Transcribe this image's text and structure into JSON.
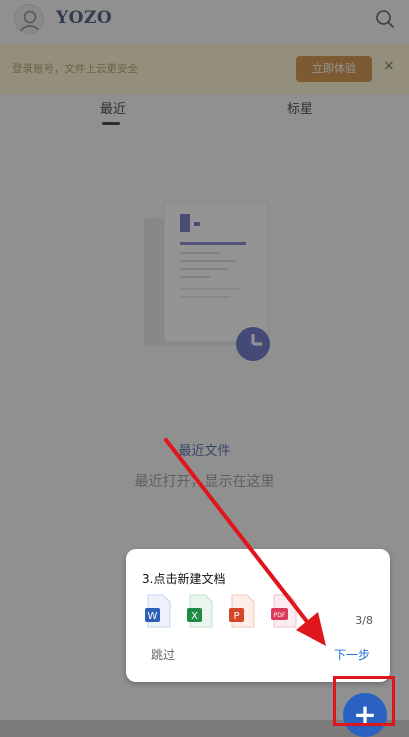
{
  "header": {
    "brand": "YOZO"
  },
  "banner": {
    "text": "登录账号，文件上云更安全",
    "button": "立即体验",
    "close": "×"
  },
  "tabs": [
    {
      "label": "最近"
    },
    {
      "label": "标星"
    }
  ],
  "empty_state": {
    "title": "最近文件",
    "subtitle": "最近打开，显示在这里"
  },
  "tooltip": {
    "title": "3.点击新建文档",
    "step": "3/8",
    "skip": "跳过",
    "next": "下一步",
    "file_types": [
      {
        "name": "word-icon",
        "letter": "W",
        "color": "#2b5fb8"
      },
      {
        "name": "excel-icon",
        "letter": "X",
        "color": "#1e8a44"
      },
      {
        "name": "ppt-icon",
        "letter": "P",
        "color": "#d24726"
      },
      {
        "name": "pdf-icon",
        "letter": "PDF",
        "color": "#d83b5b"
      }
    ]
  },
  "fab": {
    "label": "+"
  },
  "colors": {
    "accent": "#2962c0",
    "annotation_red": "#e0161d",
    "banner_button": "#c9822c"
  }
}
